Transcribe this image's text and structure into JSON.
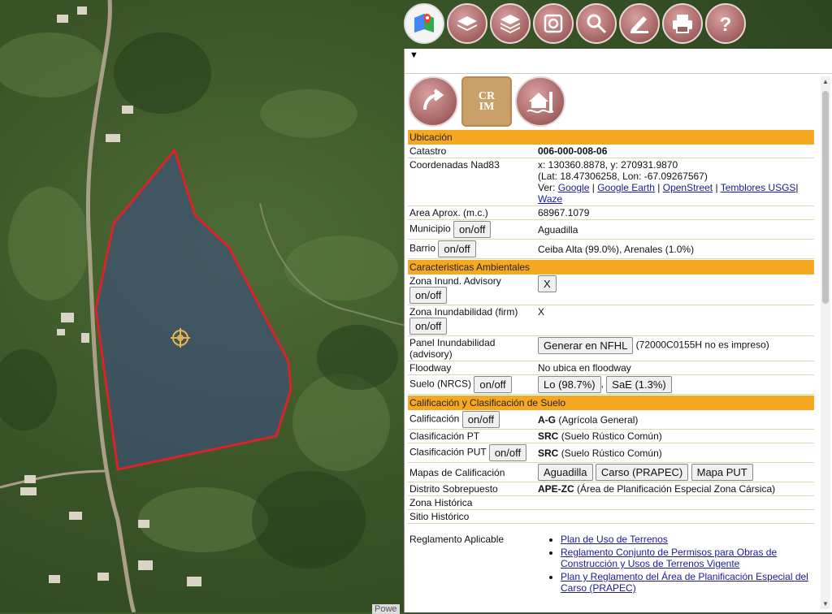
{
  "toolbar": {
    "icons": [
      "google-maps-icon",
      "layers-icon",
      "basemap-layers-icon",
      "geocode-icon",
      "search-icon",
      "draw-measure-icon",
      "print-icon",
      "help-icon"
    ]
  },
  "panel": {
    "collapse_arrow": "▼",
    "action_icons": {
      "crim_top": "CR",
      "crim_bottom": "IM"
    },
    "sections": {
      "ubicacion": "Ubicación",
      "ambientales": "Caracteristicas Ambientales",
      "calificacion": "Calificación y Clasificación de Suelo"
    },
    "ubicacion": {
      "catastro_label": "Catastro",
      "catastro_value": "006-000-008-06",
      "coords_label": "Coordenadas Nad83",
      "coords_xy": "x: 130360.8878, y: 270931.9870",
      "coords_latlon": "(Lat: 18.47306258, Lon: -67.09267567)",
      "ver_label": "Ver:",
      "links": [
        "Google",
        "Google Earth",
        "OpenStreet",
        "Temblores USGS",
        "Waze"
      ],
      "sep": "|",
      "area_label": "Area Aprox. (m.c.)",
      "area_value": "68967.1079",
      "municipio_label": "Municipio",
      "municipio_value": "Aguadilla",
      "barrio_label": "Barrio",
      "barrio_value": "Ceiba Alta (99.0%), Arenales (1.0%)",
      "onoff": "on/off"
    },
    "ambientales": {
      "zona_adv_label": "Zona Inund. Advisory",
      "zona_adv_btn": "X",
      "zona_firm_label": "Zona Inundabilidad (firm)",
      "zona_firm_value": "X",
      "panel_label": "Panel Inundabilidad (advisory)",
      "panel_btn": "Generar en NFHL",
      "panel_value": "(72000C0155H no es impreso)",
      "floodway_label": "Floodway",
      "floodway_value": "No ubica en floodway",
      "suelo_label": "Suelo (NRCS)",
      "suelo_btn1": "Lo (98.7%)",
      "suelo_sep": ",",
      "suelo_btn2": "SaE (1.3%)"
    },
    "calificacion": {
      "calif_label": "Calificación",
      "calif_code": "A-G",
      "calif_desc": "(Agrícola General)",
      "clasif_pt_label": "Clasificación PT",
      "clasif_pt_code": "SRC",
      "clasif_pt_desc": "(Suelo Rústico Común)",
      "clasif_put_label": "Clasificación PUT",
      "clasif_put_code": "SRC",
      "clasif_put_desc": "(Suelo Rústico Común)",
      "mapas_label": "Mapas de Calificación",
      "mapas_btns": [
        "Aguadilla",
        "Carso (PRAPEC)",
        "Mapa PUT"
      ],
      "distrito_label": "Distrito Sobrepuesto",
      "distrito_code": "APE-ZC",
      "distrito_desc": "(Área de Planificación Especial Zona Cársica)",
      "zona_hist_label": "Zona Histórica",
      "sitio_hist_label": "Sitio Histórico",
      "reglamento_label": "Reglamento Aplicable",
      "reglamentos": [
        "Plan de Uso de Terrenos",
        "Reglamento Conjunto de Permisos para Obras de Construcción y Usos de Terrenos Vigente",
        "Plan y Reglamento del Área de Planificación Especial del Carso (PRAPEC)"
      ]
    }
  },
  "map": {
    "powered": "Powe"
  },
  "colors": {
    "section_bg": "#f7a823",
    "parcel_outline": "#d8232a",
    "button_red": "#a36262"
  }
}
